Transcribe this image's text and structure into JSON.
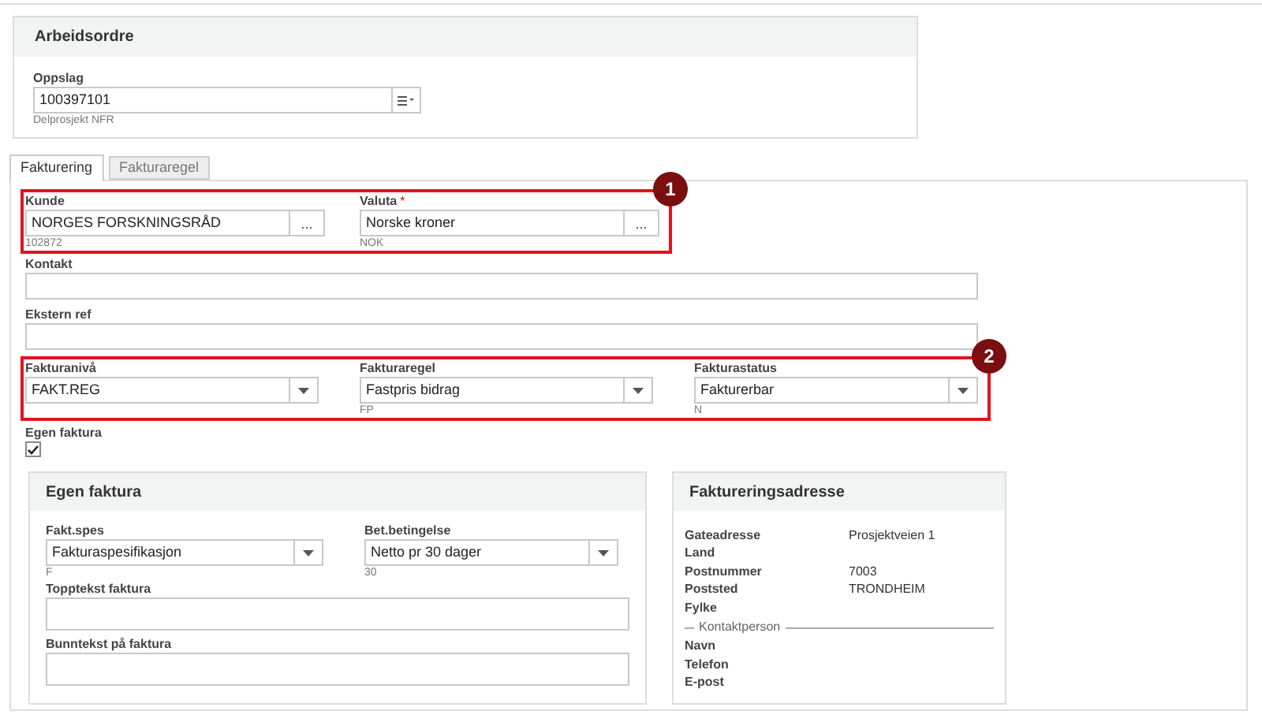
{
  "panel": {
    "title": "Arbeidsordre",
    "lookup": {
      "kind": "menu",
      "label": "Oppslag",
      "value": "100397101",
      "hint": "Delprosjekt NFR"
    }
  },
  "tabs": [
    {
      "label": "Fakturering",
      "selected": true
    },
    {
      "label": "Fakturaregel",
      "selected": false
    }
  ],
  "rows": [
    {
      "highlight": "1",
      "fields": [
        {
          "kind": "lookup",
          "label": "Kunde",
          "value": "NORGES FORSKNINGSRÅD",
          "button": "...",
          "hint": "102872"
        },
        {
          "kind": "lookup",
          "label": "Valuta",
          "required": "*",
          "value": "Norske kroner",
          "button": "...",
          "hint": "NOK"
        }
      ]
    },
    {
      "fields": [
        {
          "kind": "text",
          "label": "Kontakt"
        }
      ]
    },
    {
      "fields": [
        {
          "kind": "text",
          "label": "Ekstern ref"
        }
      ]
    },
    {
      "highlight": "2",
      "fields": [
        {
          "kind": "select",
          "label": "Fakturanivå",
          "value": "FAKT.REG"
        },
        {
          "kind": "select",
          "label": "Fakturaregel",
          "value": "Fastpris bidrag",
          "hint": "FP"
        },
        {
          "kind": "select",
          "label": "Fakturastatus",
          "value": "Fakturerbar",
          "hint": "N"
        }
      ]
    }
  ],
  "own_invoice": {
    "label": "Egen faktura",
    "checked": true
  },
  "invoice_panel": {
    "title": "Egen faktura",
    "rows": [
      {
        "fields": [
          {
            "kind": "select",
            "label": "Fakt.spes",
            "value": "Fakturaspesifikasjon",
            "hint": "F"
          },
          {
            "kind": "select",
            "label": "Bet.betingelse",
            "value": "Netto pr 30 dager",
            "hint": "30"
          }
        ]
      },
      {
        "fields": [
          {
            "kind": "textarea",
            "label": "Topptekst faktura"
          }
        ]
      },
      {
        "fields": [
          {
            "kind": "textarea",
            "label": "Bunntekst på faktura"
          }
        ]
      }
    ]
  },
  "address_panel": {
    "title": "Faktureringsadresse",
    "rows": [
      {
        "label": "Gateadresse",
        "value": "Prosjektveien 1"
      },
      {
        "label": "Land"
      },
      {
        "label": "Postnummer",
        "value": "7003"
      },
      {
        "label": "Poststed",
        "value": "TRONDHEIM"
      },
      {
        "label": "Fylke"
      }
    ],
    "contact_title": "Kontaktperson",
    "contact_rows": [
      {
        "label": "Navn"
      },
      {
        "label": "Telefon"
      },
      {
        "label": "E-post"
      }
    ]
  }
}
